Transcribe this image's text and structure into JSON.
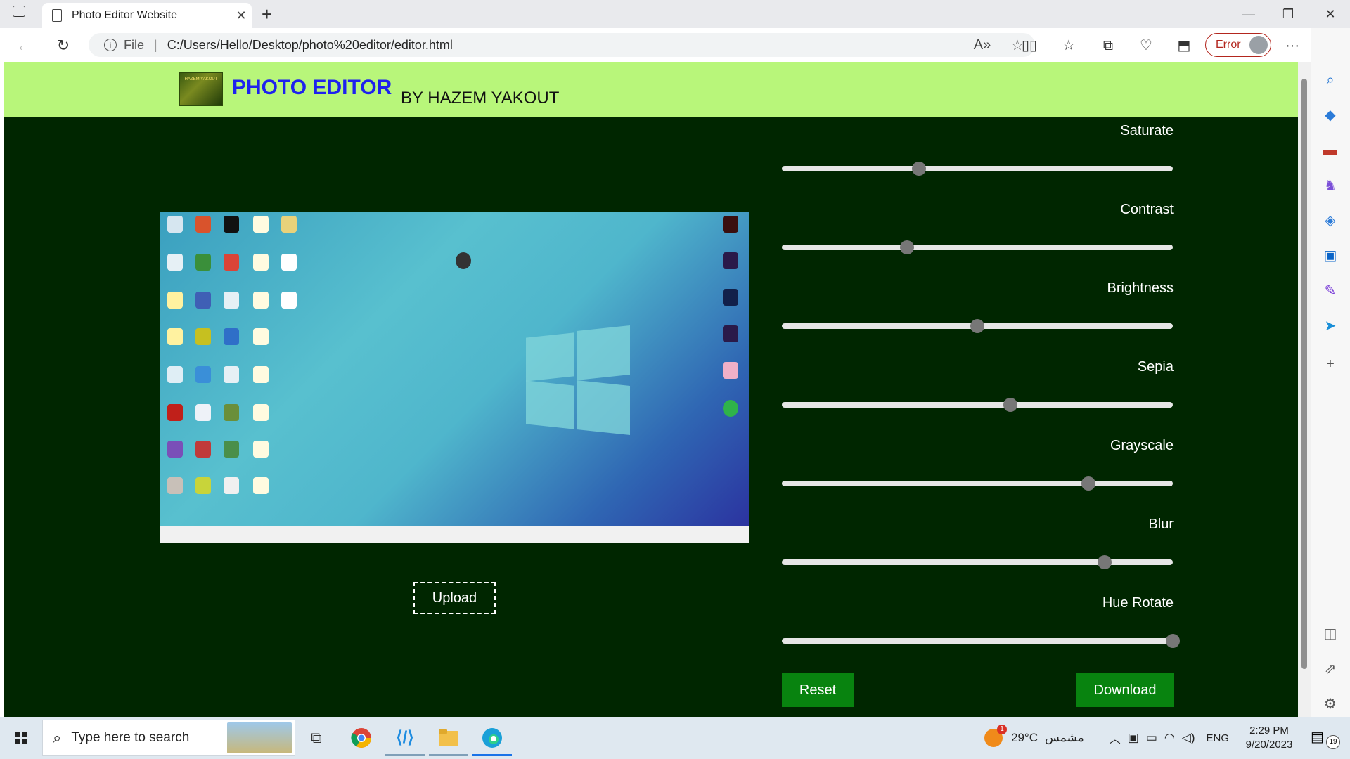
{
  "browser": {
    "tab_title": "Photo Editor Website",
    "file_label": "File",
    "url": "C:/Users/Hello/Desktop/photo%20editor/editor.html",
    "profile_status": "Error"
  },
  "header": {
    "logo_text": "HAZEM YAKOUT",
    "title": "PHOTO EDITOR",
    "byline": "BY HAZEM YAKOUT"
  },
  "editor": {
    "upload_label": "Upload",
    "filters": [
      {
        "label": "Saturate",
        "value": 0.35
      },
      {
        "label": "Contrast",
        "value": 0.32
      },
      {
        "label": "Brightness",
        "value": 0.5
      },
      {
        "label": "Sepia",
        "value": 0.585
      },
      {
        "label": "Grayscale",
        "value": 0.785
      },
      {
        "label": "Blur",
        "value": 0.825
      },
      {
        "label": "Hue Rotate",
        "value": 1.0
      }
    ],
    "reset_label": "Reset",
    "download_label": "Download"
  },
  "taskbar": {
    "search_placeholder": "Type here to search",
    "weather_badge": "1",
    "temperature": "29°C",
    "weather_text": "مشمس",
    "language": "ENG",
    "time": "2:29 PM",
    "date": "9/20/2023",
    "notification_count": "19"
  },
  "colors": {
    "header_bg": "#b8f67a",
    "content_bg": "#002600",
    "title": "#1e22ee",
    "button_bg": "#08830f"
  }
}
